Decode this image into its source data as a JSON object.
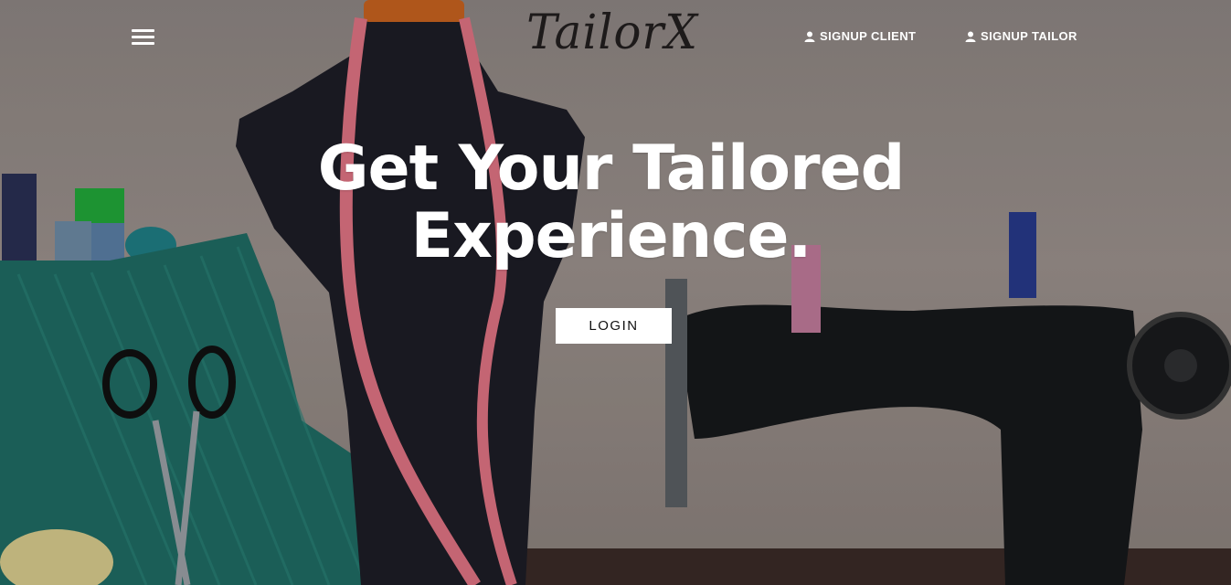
{
  "nav": {
    "logo": "TailorX",
    "signup_client": "SIGNUP CLIENT",
    "signup_tailor": "SIGNUP TAILOR"
  },
  "hero": {
    "headline_line1": "Get Your Tailored",
    "headline_line2": "Experience.",
    "login_label": "LOGIN"
  },
  "colors": {
    "backdrop": "#8e8683",
    "text_light": "#ffffff",
    "logo_dark": "#1d1a1a",
    "fabric_teal": "#1f6b63",
    "mannequin": "#1d1d26",
    "tape_pink": "#e07483"
  },
  "icons": {
    "menu": "hamburger-menu-icon",
    "user": "user-icon"
  }
}
